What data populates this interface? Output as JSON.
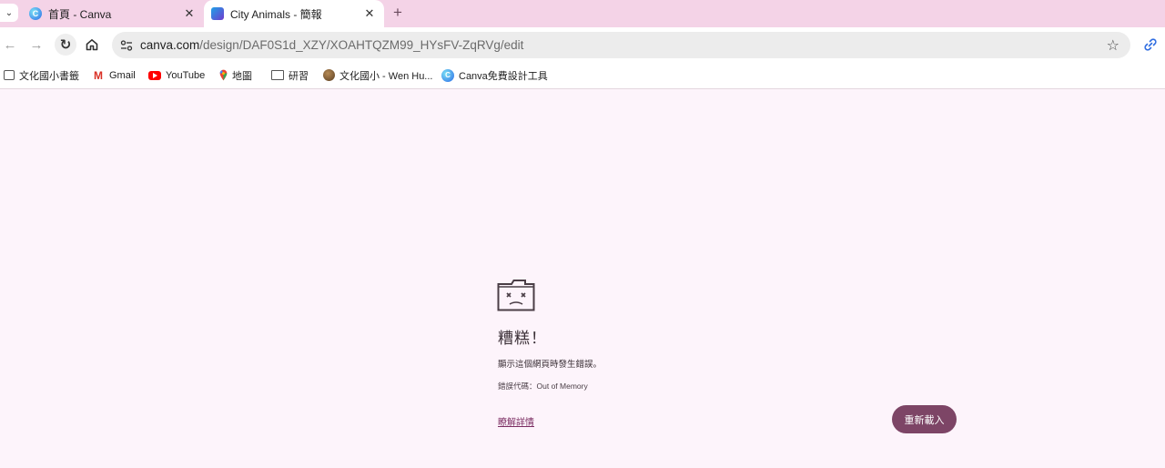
{
  "tabs": [
    {
      "title": "首頁 - Canva",
      "icon": "canva-icon",
      "active": false
    },
    {
      "title": "City Animals - 簡報",
      "icon": "city-animals-icon",
      "active": true
    }
  ],
  "toolbar": {
    "url_host": "canva.com",
    "url_path": "/design/DAF0S1d_XZY/XOAHTQZM99_HYsFV-ZqRVg/edit"
  },
  "bookmarks": [
    {
      "label": "文化國小書籤",
      "icon": "bookmark-apps-icon"
    },
    {
      "label": "Gmail",
      "icon": "gmail-icon"
    },
    {
      "label": "YouTube",
      "icon": "youtube-icon"
    },
    {
      "label": "地圖",
      "icon": "maps-icon"
    },
    {
      "label": "研習",
      "icon": "folder-icon"
    },
    {
      "label": "文化國小 - Wen Hu...",
      "icon": "avatar-icon"
    },
    {
      "label": "Canva免費設計工具",
      "icon": "canva-icon"
    }
  ],
  "error": {
    "title": "糟糕！",
    "description": "顯示這個網頁時發生錯誤。",
    "code": "錯誤代碼：Out of Memory",
    "learn_more": "瞭解詳情",
    "reload_button": "重新載入"
  },
  "colors": {
    "tabstrip": "#f4d3e7",
    "page_background": "#fdf4fb",
    "accent": "#7d4566",
    "link": "#7b2d62"
  }
}
